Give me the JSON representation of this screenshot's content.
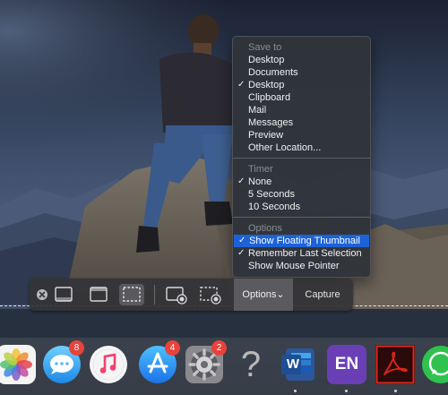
{
  "menu": {
    "sections": [
      {
        "header": "Save to",
        "items": [
          {
            "label": "Desktop",
            "checked": false,
            "highlighted": false
          },
          {
            "label": "Documents",
            "checked": false,
            "highlighted": false
          },
          {
            "label": "Desktop",
            "checked": true,
            "highlighted": false
          },
          {
            "label": "Clipboard",
            "checked": false,
            "highlighted": false
          },
          {
            "label": "Mail",
            "checked": false,
            "highlighted": false
          },
          {
            "label": "Messages",
            "checked": false,
            "highlighted": false
          },
          {
            "label": "Preview",
            "checked": false,
            "highlighted": false
          },
          {
            "label": "Other Location...",
            "checked": false,
            "highlighted": false
          }
        ]
      },
      {
        "header": "Timer",
        "items": [
          {
            "label": "None",
            "checked": true,
            "highlighted": false
          },
          {
            "label": "5 Seconds",
            "checked": false,
            "highlighted": false
          },
          {
            "label": "10 Seconds",
            "checked": false,
            "highlighted": false
          }
        ]
      },
      {
        "header": "Options",
        "items": [
          {
            "label": "Show Floating Thumbnail",
            "checked": true,
            "highlighted": true
          },
          {
            "label": "Remember Last Selection",
            "checked": true,
            "highlighted": false
          },
          {
            "label": "Show Mouse Pointer",
            "checked": false,
            "highlighted": false
          }
        ]
      }
    ],
    "checkmark": "✓"
  },
  "toolbar": {
    "buttons": [
      {
        "name": "close",
        "icon": "close-circle-icon"
      },
      {
        "name": "capture-entire-screen",
        "icon": "entire-screen-icon"
      },
      {
        "name": "capture-selected-window",
        "icon": "window-icon"
      },
      {
        "name": "capture-selected-portion",
        "icon": "dashed-selection-icon",
        "active": true
      },
      {
        "name": "record-entire-screen",
        "icon": "record-screen-icon"
      },
      {
        "name": "record-selected-portion",
        "icon": "record-selection-icon"
      }
    ],
    "options_label": "Options",
    "options_chevron": "⌄",
    "capture_label": "Capture"
  },
  "dock": {
    "apps": [
      {
        "name": "Photos",
        "icon": "photos-icon"
      },
      {
        "name": "Messages",
        "icon": "messages-icon",
        "badge": "8"
      },
      {
        "name": "Music",
        "icon": "music-icon"
      },
      {
        "name": "App Store",
        "icon": "app-store-icon",
        "badge": "4"
      },
      {
        "name": "System Preferences",
        "icon": "system-preferences-icon",
        "badge": "2"
      },
      {
        "name": "Unknown",
        "icon": "question-icon",
        "glyph": "?"
      },
      {
        "name": "Microsoft Word",
        "icon": "word-icon",
        "glyph": "W"
      },
      {
        "name": "EN",
        "icon": "en-app-icon",
        "glyph": "EN"
      },
      {
        "name": "Adobe Acrobat",
        "icon": "acrobat-icon"
      },
      {
        "name": "WhatsApp",
        "icon": "whatsapp-icon"
      }
    ]
  },
  "colors": {
    "highlight": "#1c62d6",
    "badge": "#e8423b",
    "menu_background": "#30343a"
  }
}
